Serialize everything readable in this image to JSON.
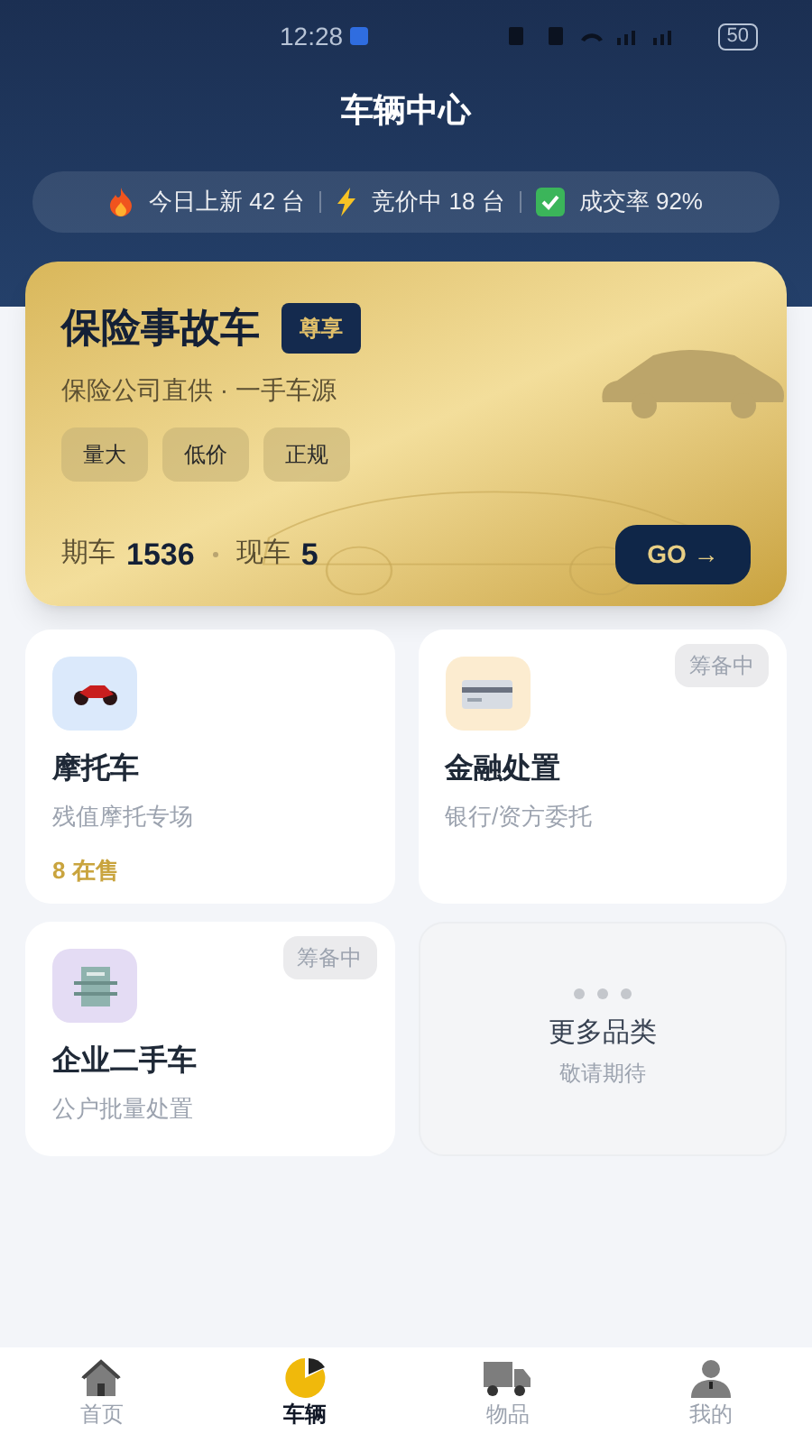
{
  "status_bar": {
    "time": "12:28",
    "battery": "50"
  },
  "header": {
    "title": "车辆中心"
  },
  "stats": [
    {
      "kind": "fire",
      "text": "今日上新 42 台"
    },
    {
      "kind": "bolt",
      "text": "竞价中 18 台"
    },
    {
      "kind": "check",
      "text": "成交率 92%"
    }
  ],
  "featured": {
    "title": "保险事故车",
    "badge": "尊享",
    "subtitle": "保险公司直供 · 一手车源",
    "tags": [
      "量大",
      "低价",
      "正规"
    ],
    "counts": [
      {
        "label": "期车",
        "value": "1536"
      },
      {
        "label": "现车",
        "value": "5"
      }
    ],
    "button": "GO →"
  },
  "categories": [
    {
      "kind": "motorcycle",
      "title": "摩托车",
      "subtitle": "残值摩托专场",
      "count": "8 在售"
    },
    {
      "kind": "card",
      "title": "金融处置",
      "subtitle": "银行/资方委托",
      "badge": "筹备中"
    },
    {
      "kind": "building",
      "title": "企业二手车",
      "subtitle": "公户批量处置",
      "badge": "筹备中"
    },
    {
      "kind": "more",
      "title": "更多品类",
      "subtitle": "敬请期待"
    }
  ],
  "nav": [
    {
      "kind": "home",
      "label": "首页",
      "selected": false
    },
    {
      "kind": "pie",
      "label": "车辆",
      "selected": true
    },
    {
      "kind": "truck",
      "label": "物品",
      "selected": false
    },
    {
      "kind": "user",
      "label": "我的",
      "selected": false
    }
  ]
}
